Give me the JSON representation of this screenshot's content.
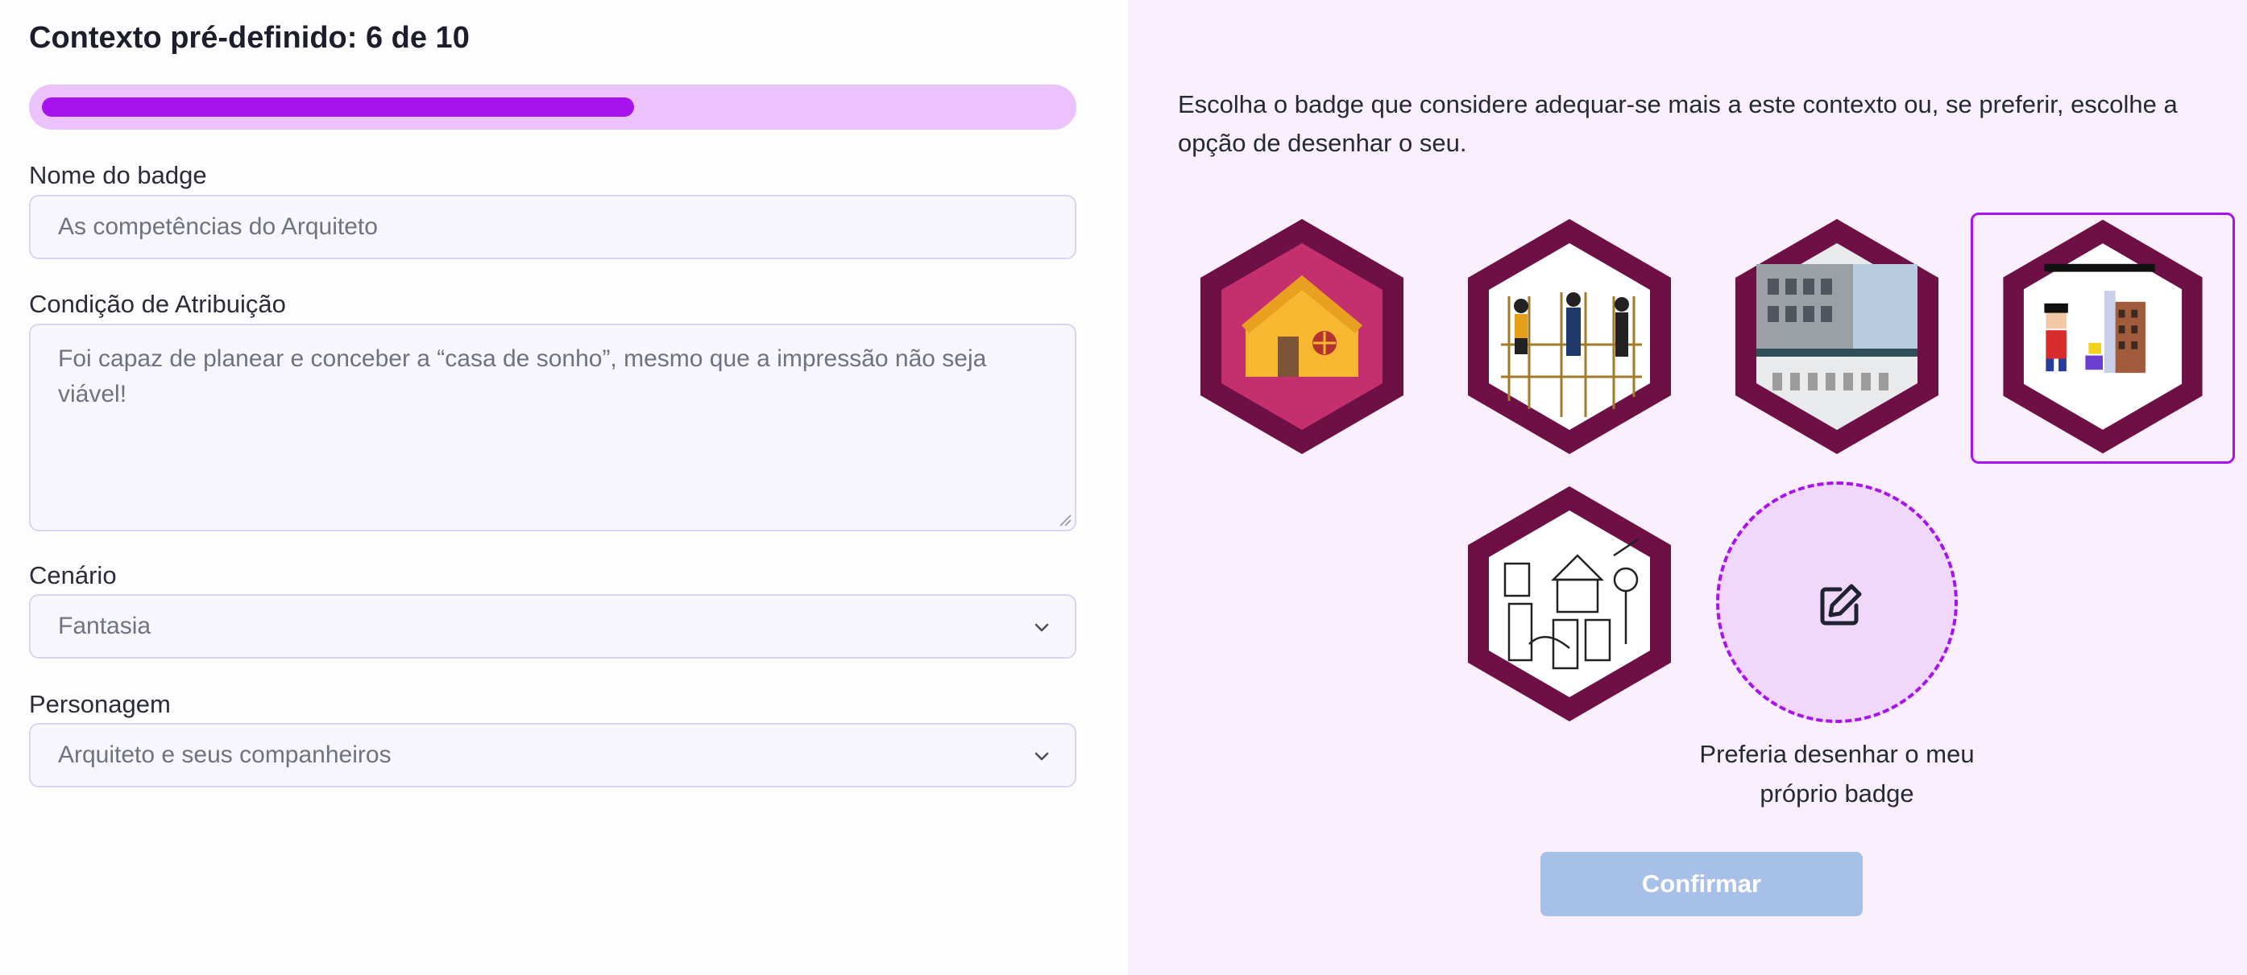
{
  "header": {
    "title": "Contexto pré-definido: 6 de 10"
  },
  "progress": {
    "current": 6,
    "total": 10,
    "fill_fraction": 0.58
  },
  "form": {
    "badge_name": {
      "label": "Nome do badge",
      "placeholder": "As competências do Arquiteto"
    },
    "condition": {
      "label": "Condição de Atribuição",
      "placeholder": "Foi capaz de planear e conceber a “casa de sonho”, mesmo que a impressão não seja viável!"
    },
    "scenario": {
      "label": "Cenário",
      "value": "Fantasia"
    },
    "character": {
      "label": "Personagem",
      "value": "Arquiteto e seus companheiros"
    }
  },
  "badges": {
    "instruction": "Escolha o badge que considere adequar-se mais a este contexto ou, se preferir, escolhe a opção de desenhar o seu.",
    "items": [
      {
        "icon": "house-badge-icon",
        "selected": false
      },
      {
        "icon": "workers-scaffold-badge-icon",
        "selected": false
      },
      {
        "icon": "building-facade-badge-icon",
        "selected": false
      },
      {
        "icon": "pixel-characters-badge-icon",
        "selected": true
      },
      {
        "icon": "sketch-figures-badge-icon",
        "selected": false
      }
    ],
    "draw_own_label": "Preferia desenhar o meu próprio badge"
  },
  "actions": {
    "confirm_label": "Confirmar"
  },
  "colors": {
    "accent": "#a713ef",
    "progress_track": "#ebc2fb",
    "badge_frame": "#6e0f46",
    "right_panel_bg": "#f9effd",
    "confirm_disabled": "#a7c0e8"
  }
}
